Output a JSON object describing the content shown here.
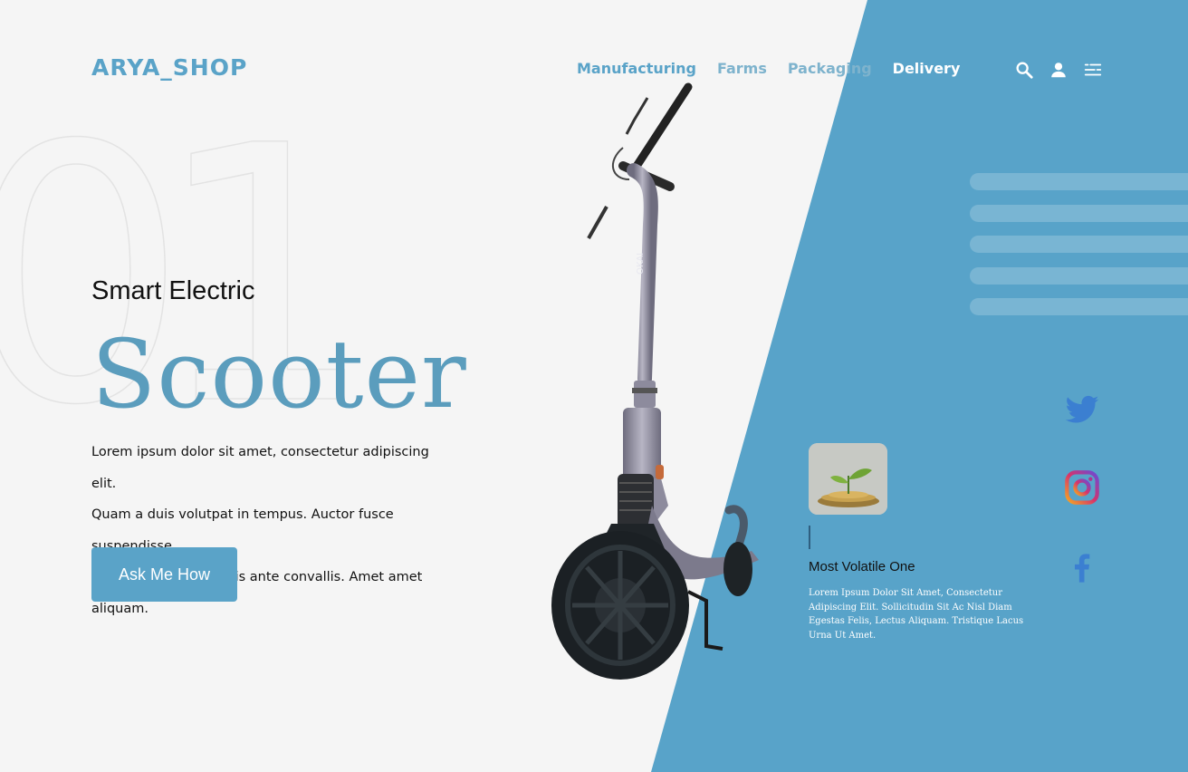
{
  "brand": {
    "logo_text": "ARYA_SHOP"
  },
  "nav": {
    "items": [
      {
        "label": "Manufacturing"
      },
      {
        "label": "Farms"
      },
      {
        "label": "Packaging"
      },
      {
        "label": "Delivery"
      }
    ],
    "icons": [
      "search-icon",
      "user-icon",
      "menu-icon"
    ]
  },
  "hero": {
    "background_number": "01",
    "subtitle": "Smart Electric",
    "title": "Scooter",
    "description_lines": [
      "Lorem ipsum dolor sit amet, consectetur adipiscing elit.",
      "Quam a duis volutpat in tempus. Auctor fusce suspendisse",
      "eros, a, massa sed quis ante convallis. Amet amet aliquam."
    ],
    "cta_label": "Ask Me How"
  },
  "card": {
    "title": "Most Volatile One",
    "text": "Lorem Ipsum Dolor Sit Amet, Consectetur Adipiscing Elit. Sollicitudin Sit Ac Nisl Diam Egestas Felis, Lectus Aliquam. Tristique Lacus Urna Ut Amet."
  },
  "social": [
    "twitter-icon",
    "instagram-icon",
    "facebook-icon"
  ],
  "colors": {
    "accent": "#5aa3c8",
    "background": "#f5f5f5",
    "panel": "#58a3c9",
    "title": "#5b9dbd"
  }
}
